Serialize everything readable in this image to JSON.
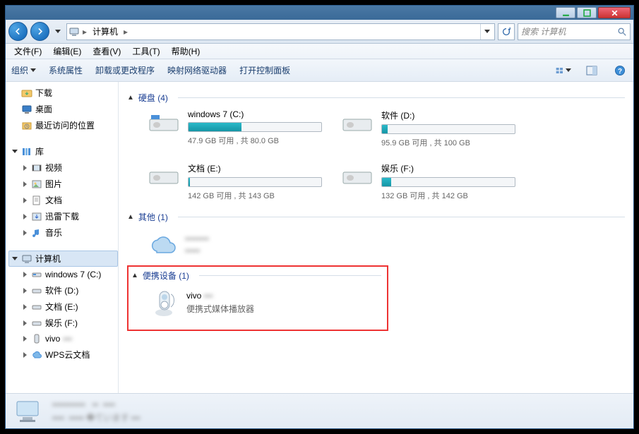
{
  "titlebar": {
    "min": "–",
    "max": "□",
    "close": "×"
  },
  "address": {
    "root": "计算机",
    "search_placeholder": "搜索 计算机"
  },
  "menu": {
    "file": "文件(F)",
    "edit": "编辑(E)",
    "view": "查看(V)",
    "tools": "工具(T)",
    "help": "帮助(H)"
  },
  "toolbar": {
    "organize": "组织",
    "sysprops": "系统属性",
    "uninstall": "卸载或更改程序",
    "mapdrive": "映射网络驱动器",
    "controlpanel": "打开控制面板"
  },
  "nav": {
    "downloads": "下载",
    "desktop": "桌面",
    "recent": "最近访问的位置",
    "libraries": "库",
    "videos": "视频",
    "pictures": "图片",
    "documents": "文档",
    "xunlei": "迅雷下载",
    "music": "音乐",
    "computer": "计算机",
    "drives": {
      "c": "windows 7 (C:)",
      "d": "软件 (D:)",
      "e": "文档 (E:)",
      "f": "娱乐 (F:)",
      "vivo": "vivo",
      "wps": "WPS云文档"
    }
  },
  "groups": {
    "hdd": {
      "title": "硬盘 (4)"
    },
    "other": {
      "title": "其他 (1)"
    },
    "portable": {
      "title": "便携设备 (1)"
    }
  },
  "drives": {
    "c": {
      "name": "windows 7 (C:)",
      "free": "47.9 GB 可用 , 共 80.0 GB",
      "pct": 40
    },
    "d": {
      "name": "软件 (D:)",
      "free": "95.9 GB 可用 , 共 100 GB",
      "pct": 4
    },
    "e": {
      "name": "文档 (E:)",
      "free": "142 GB 可用 , 共 143 GB",
      "pct": 1
    },
    "f": {
      "name": "娱乐 (F:)",
      "free": "132 GB 可用 , 共 142 GB",
      "pct": 7
    }
  },
  "portable": {
    "name": "vivo",
    "desc": "便携式媒体播放器"
  }
}
